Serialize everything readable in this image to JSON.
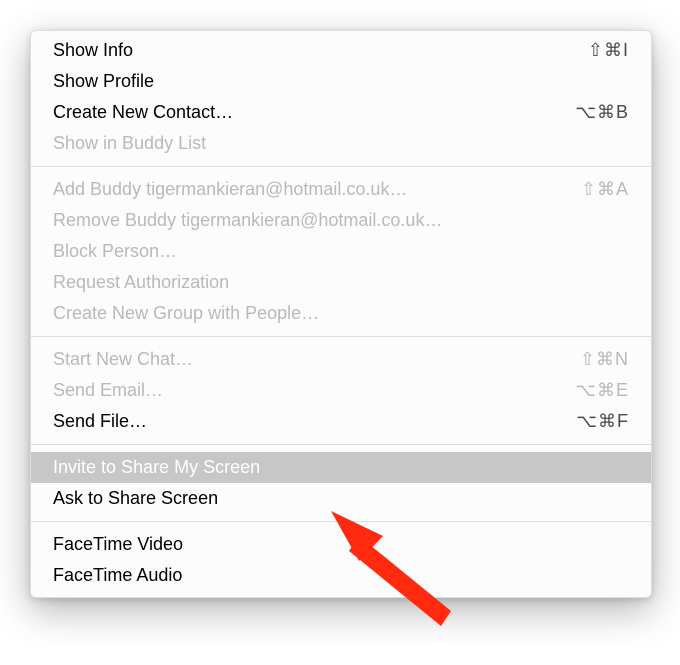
{
  "menu": {
    "groups": [
      [
        {
          "label": "Show Info",
          "shortcut": "⇧⌘I",
          "enabled": true
        },
        {
          "label": "Show Profile",
          "shortcut": "",
          "enabled": true
        },
        {
          "label": "Create New Contact…",
          "shortcut": "⌥⌘B",
          "enabled": true
        },
        {
          "label": "Show in Buddy List",
          "shortcut": "",
          "enabled": false
        }
      ],
      [
        {
          "label": "Add Buddy tigermankieran@hotmail.co.uk…",
          "shortcut": "⇧⌘A",
          "enabled": false
        },
        {
          "label": "Remove Buddy tigermankieran@hotmail.co.uk…",
          "shortcut": "",
          "enabled": false
        },
        {
          "label": "Block Person…",
          "shortcut": "",
          "enabled": false
        },
        {
          "label": "Request Authorization",
          "shortcut": "",
          "enabled": false
        },
        {
          "label": "Create New Group with People…",
          "shortcut": "",
          "enabled": false
        }
      ],
      [
        {
          "label": "Start New Chat…",
          "shortcut": "⇧⌘N",
          "enabled": false
        },
        {
          "label": "Send Email…",
          "shortcut": "⌥⌘E",
          "enabled": false
        },
        {
          "label": "Send File…",
          "shortcut": "⌥⌘F",
          "enabled": true
        }
      ],
      [
        {
          "label": "Invite to Share My Screen",
          "shortcut": "",
          "enabled": true,
          "highlight": true
        },
        {
          "label": "Ask to Share Screen",
          "shortcut": "",
          "enabled": true
        }
      ],
      [
        {
          "label": "FaceTime Video",
          "shortcut": "",
          "enabled": true
        },
        {
          "label": "FaceTime Audio",
          "shortcut": "",
          "enabled": true
        }
      ]
    ]
  },
  "annotation": {
    "arrow_color": "#ff2a10"
  }
}
